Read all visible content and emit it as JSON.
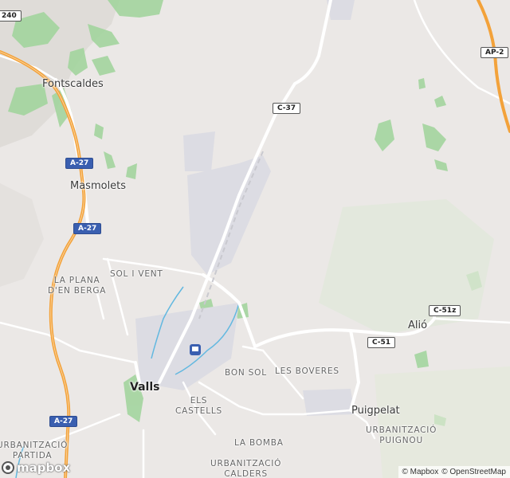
{
  "map": {
    "towns": [
      {
        "key": "fontscaldes",
        "label": "Fontscaldes"
      },
      {
        "key": "masmolets",
        "label": "Masmolets"
      },
      {
        "key": "valls",
        "label": "Valls"
      },
      {
        "key": "alio",
        "label": "Alió"
      },
      {
        "key": "puigpelat",
        "label": "Puigpelat"
      }
    ],
    "districts": [
      {
        "key": "sol-i-vent",
        "label": "SOL I VENT"
      },
      {
        "key": "la-plana",
        "label": "LA PLANA\nD'EN BERGA"
      },
      {
        "key": "bon-sol",
        "label": "BON SOL"
      },
      {
        "key": "les-boveres",
        "label": "LES BOVERES"
      },
      {
        "key": "els-castells",
        "label": "ELS\nCASTELLS"
      },
      {
        "key": "urb-puignou",
        "label": "URBANITZACIÓ\nPUIGNOU"
      },
      {
        "key": "la-bomba",
        "label": "LA BOMBA"
      },
      {
        "key": "urb-calders",
        "label": "URBANITZACIÓ\nCALDERS"
      },
      {
        "key": "urb-partida",
        "label": "URBANITZACIÓ\nPARTIDA"
      }
    ],
    "road_shields": [
      {
        "key": "240",
        "label": "240",
        "style": "white"
      },
      {
        "key": "ap2",
        "label": "AP-2",
        "style": "white"
      },
      {
        "key": "c37",
        "label": "C-37",
        "style": "white"
      },
      {
        "key": "a27-1",
        "label": "A-27",
        "style": "blue"
      },
      {
        "key": "a27-2",
        "label": "A-27",
        "style": "blue"
      },
      {
        "key": "a27-3",
        "label": "A-27",
        "style": "blue"
      },
      {
        "key": "c51z",
        "label": "C-51z",
        "style": "white"
      },
      {
        "key": "c51",
        "label": "C-51",
        "style": "white"
      }
    ],
    "colors": {
      "land": "#ebe8e6",
      "park": "#9fd49a",
      "motorway": "#f3a23a",
      "road": "#ffffff",
      "water": "#62b8e0",
      "urban": "#dcdce3"
    }
  },
  "logo": {
    "text": "mapbox"
  },
  "attribution": {
    "mapbox": "© Mapbox",
    "osm": "© OpenStreetMap"
  }
}
